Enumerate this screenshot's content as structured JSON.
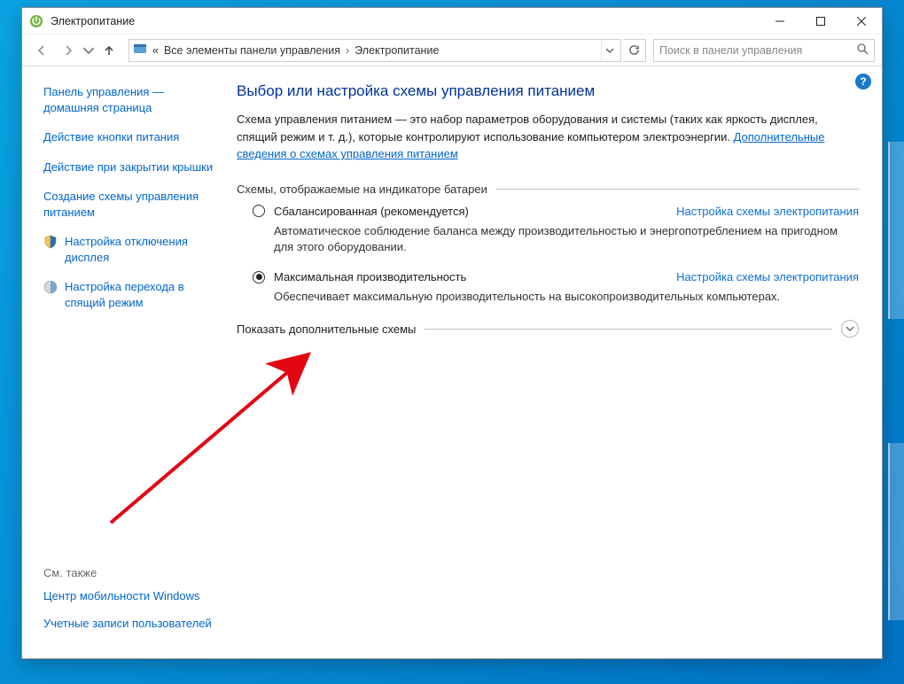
{
  "titlebar": {
    "title": "Электропитание"
  },
  "breadcrumb": {
    "chevrons": "«",
    "seg1": "Все элементы панели управления",
    "sep": "›",
    "seg2": "Электропитание"
  },
  "search": {
    "placeholder": "Поиск в панели управления"
  },
  "sidebar": {
    "home": "Панель управления — домашняя страница",
    "items": [
      "Действие кнопки питания",
      "Действие при закрытии крышки",
      "Создание схемы управления питанием",
      "Настройка отключения дисплея",
      "Настройка перехода в спящий режим"
    ],
    "see_also_label": "См. также",
    "see_also": [
      "Центр мобильности Windows",
      "Учетные записи пользователей"
    ]
  },
  "main": {
    "title": "Выбор или настройка схемы управления питанием",
    "intro_text": "Схема управления питанием — это набор параметров оборудования и системы (таких как яркость дисплея, спящий режим и т. д.), которые контролируют использование компьютером электроэнергии. ",
    "intro_link": "Дополнительные сведения о схемах управления питанием",
    "group_label": "Схемы, отображаемые на индикаторе батареи",
    "plans": [
      {
        "name": "Сбалансированная (рекомендуется)",
        "checked": false,
        "settings_link": "Настройка схемы электропитания",
        "desc": "Автоматическое соблюдение баланса между производительностью и энергопотреблением на пригодном для этого оборудовании."
      },
      {
        "name": "Максимальная производительность",
        "checked": true,
        "settings_link": "Настройка схемы электропитания",
        "desc": "Обеспечивает максимальную производительность на высокопроизводительных компьютерах."
      }
    ],
    "expander": "Показать дополнительные схемы"
  }
}
